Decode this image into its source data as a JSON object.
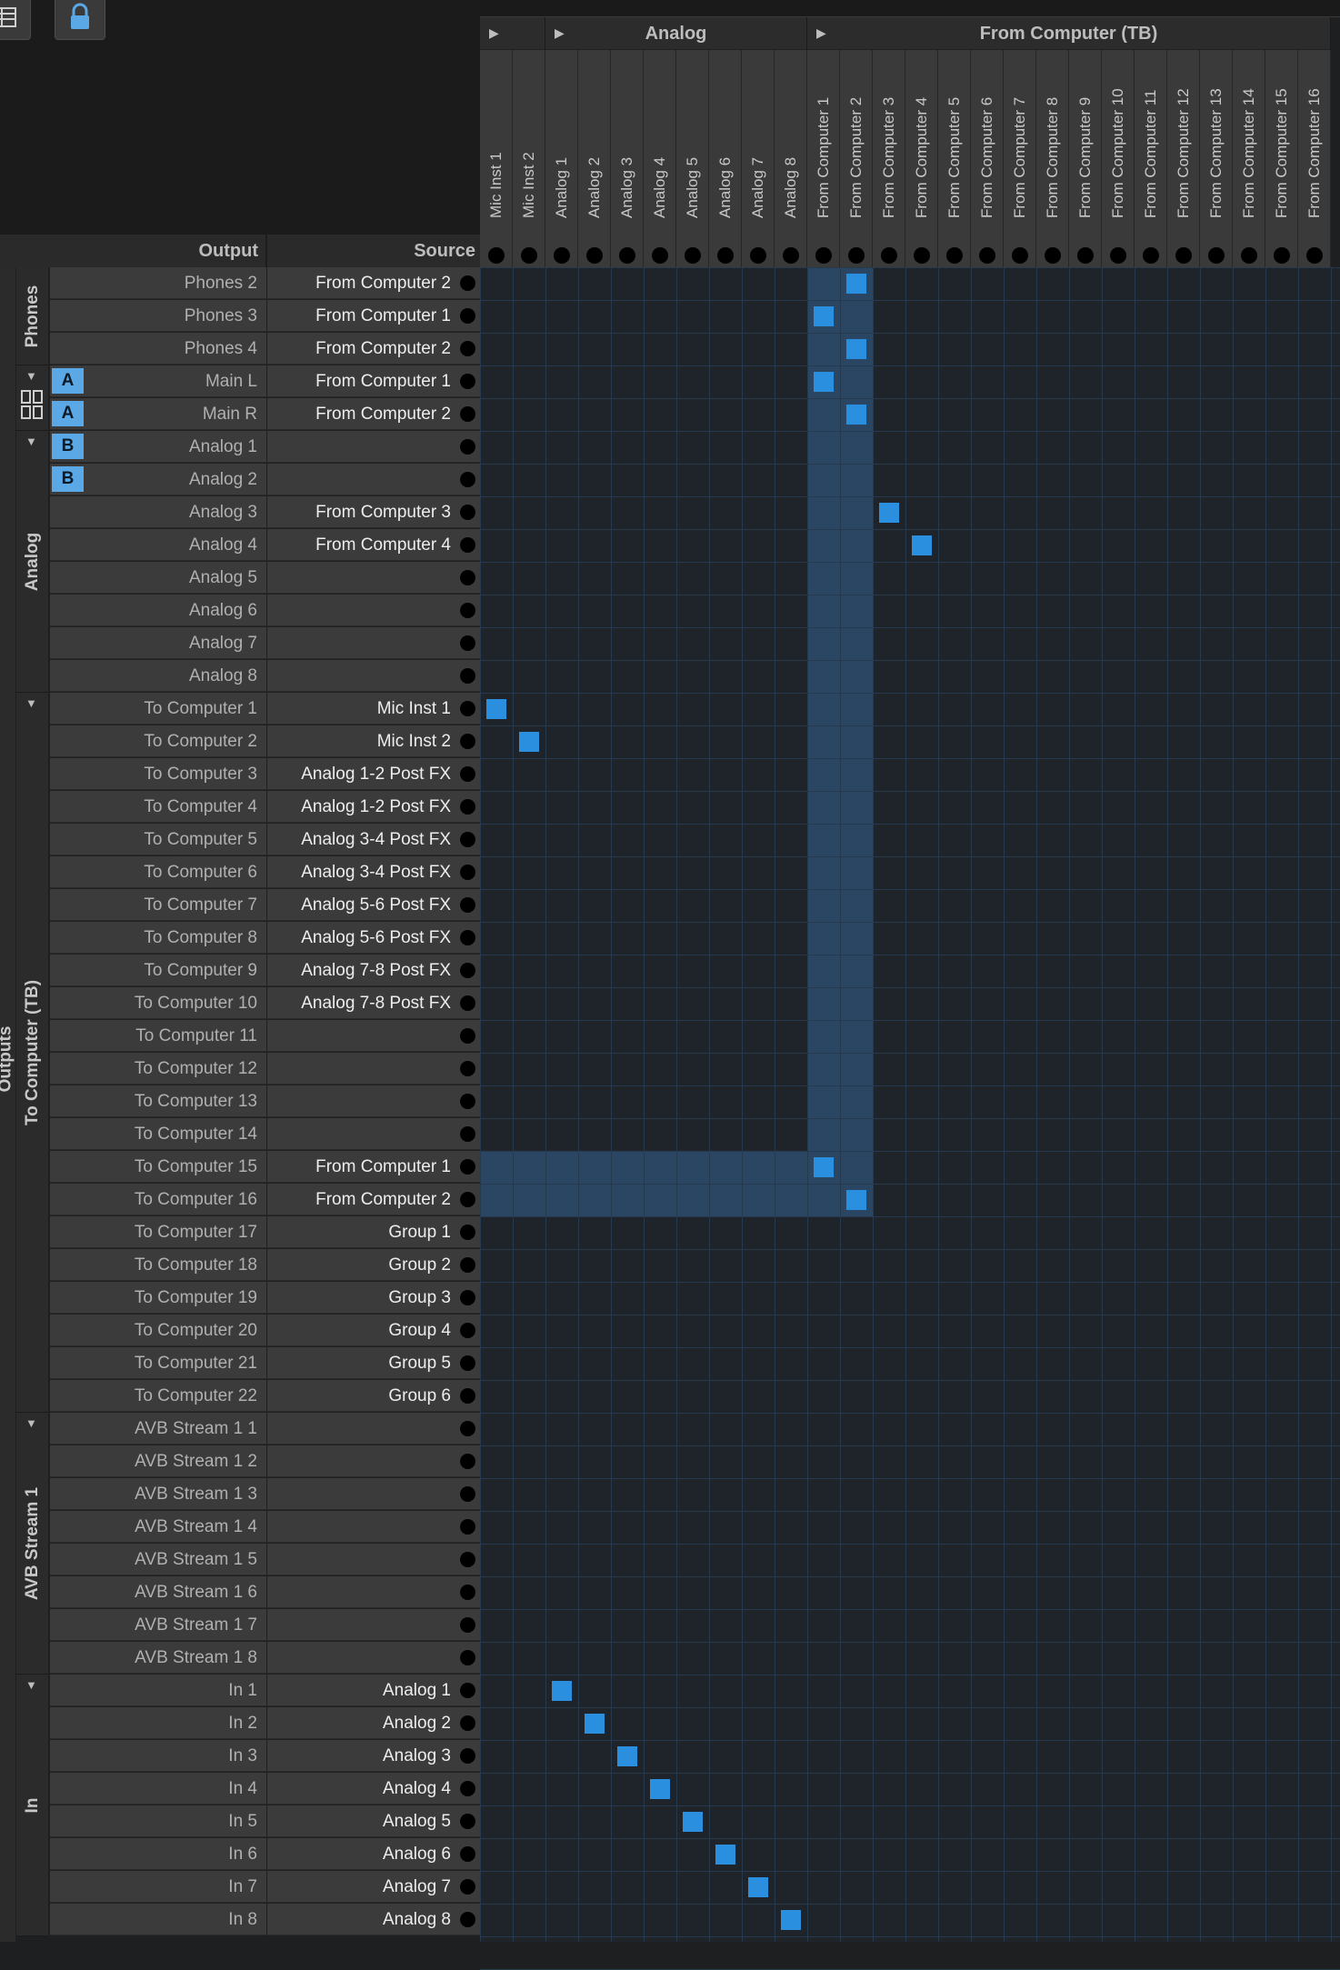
{
  "toolbar": {
    "grid_icon": "list-icon",
    "lock_icon": "lock-icon"
  },
  "headers": {
    "output": "Output",
    "source": "Source"
  },
  "column_groups": [
    {
      "label": "",
      "start": 0,
      "count": 2
    },
    {
      "label": "Analog",
      "start": 2,
      "count": 8
    },
    {
      "label": "From Computer (TB)",
      "start": 10,
      "count": 16
    }
  ],
  "columns": [
    "Mic Inst 1",
    "Mic Inst 2",
    "Analog 1",
    "Analog 2",
    "Analog 3",
    "Analog 4",
    "Analog 5",
    "Analog 6",
    "Analog 7",
    "Analog 8",
    "From Computer 1",
    "From Computer 2",
    "From Computer 3",
    "From Computer 4",
    "From Computer 5",
    "From Computer 6",
    "From Computer 7",
    "From Computer 8",
    "From Computer 9",
    "From Computer 10",
    "From Computer 11",
    "From Computer 12",
    "From Computer 13",
    "From Computer 14",
    "From Computer 15",
    "From Computer 16"
  ],
  "outer_label": "Outputs",
  "row_groups": [
    {
      "label": "Phones",
      "start": 0,
      "count": 3,
      "arrow": ""
    },
    {
      "label": "",
      "start": 3,
      "count": 2,
      "arrow": "▼",
      "icon": "speaker-pair-icon"
    },
    {
      "label": "Analog",
      "start": 5,
      "count": 8,
      "arrow": "▼"
    },
    {
      "label": "To Computer (TB)",
      "start": 13,
      "count": 22,
      "arrow": "▼"
    },
    {
      "label": "AVB Stream 1",
      "start": 35,
      "count": 8,
      "arrow": "▼"
    },
    {
      "label": "In",
      "start": 43,
      "count": 8,
      "arrow": "▼"
    }
  ],
  "rows": [
    {
      "output": "Phones 2",
      "source": "From Computer 2",
      "col": 11
    },
    {
      "output": "Phones 3",
      "source": "From Computer 1",
      "col": 10
    },
    {
      "output": "Phones 4",
      "source": "From Computer 2",
      "col": 11
    },
    {
      "output": "Main L",
      "source": "From Computer 1",
      "col": 10,
      "badge": "A"
    },
    {
      "output": "Main R",
      "source": "From Computer 2",
      "col": 11,
      "badge": "A"
    },
    {
      "output": "Analog 1",
      "source": "",
      "col": -1,
      "badge": "B"
    },
    {
      "output": "Analog 2",
      "source": "",
      "col": -1,
      "badge": "B"
    },
    {
      "output": "Analog 3",
      "source": "From Computer 3",
      "col": 12
    },
    {
      "output": "Analog 4",
      "source": "From Computer 4",
      "col": 13
    },
    {
      "output": "Analog 5",
      "source": "",
      "col": -1
    },
    {
      "output": "Analog 6",
      "source": "",
      "col": -1
    },
    {
      "output": "Analog 7",
      "source": "",
      "col": -1
    },
    {
      "output": "Analog 8",
      "source": "",
      "col": -1
    },
    {
      "output": "To Computer 1",
      "source": "Mic Inst 1",
      "col": 0
    },
    {
      "output": "To Computer 2",
      "source": "Mic Inst 2",
      "col": 1
    },
    {
      "output": "To Computer 3",
      "source": "Analog 1-2 Post FX",
      "col": -1
    },
    {
      "output": "To Computer 4",
      "source": "Analog 1-2 Post FX",
      "col": -1
    },
    {
      "output": "To Computer 5",
      "source": "Analog 3-4 Post FX",
      "col": -1
    },
    {
      "output": "To Computer 6",
      "source": "Analog 3-4 Post FX",
      "col": -1
    },
    {
      "output": "To Computer 7",
      "source": "Analog 5-6 Post FX",
      "col": -1
    },
    {
      "output": "To Computer 8",
      "source": "Analog 5-6 Post FX",
      "col": -1
    },
    {
      "output": "To Computer 9",
      "source": "Analog 7-8 Post FX",
      "col": -1
    },
    {
      "output": "To Computer 10",
      "source": "Analog 7-8 Post FX",
      "col": -1
    },
    {
      "output": "To Computer 11",
      "source": "",
      "col": -1
    },
    {
      "output": "To Computer 12",
      "source": "",
      "col": -1
    },
    {
      "output": "To Computer 13",
      "source": "",
      "col": -1
    },
    {
      "output": "To Computer 14",
      "source": "",
      "col": -1
    },
    {
      "output": "To Computer 15",
      "source": "From Computer 1",
      "col": 10
    },
    {
      "output": "To Computer 16",
      "source": "From Computer 2",
      "col": 11
    },
    {
      "output": "To Computer 17",
      "source": "Group 1",
      "col": -1
    },
    {
      "output": "To Computer 18",
      "source": "Group 2",
      "col": -1
    },
    {
      "output": "To Computer 19",
      "source": "Group 3",
      "col": -1
    },
    {
      "output": "To Computer 20",
      "source": "Group 4",
      "col": -1
    },
    {
      "output": "To Computer 21",
      "source": "Group 5",
      "col": -1
    },
    {
      "output": "To Computer 22",
      "source": "Group 6",
      "col": -1
    },
    {
      "output": "AVB Stream 1 1",
      "source": "",
      "col": -1
    },
    {
      "output": "AVB Stream 1 2",
      "source": "",
      "col": -1
    },
    {
      "output": "AVB Stream 1 3",
      "source": "",
      "col": -1
    },
    {
      "output": "AVB Stream 1 4",
      "source": "",
      "col": -1
    },
    {
      "output": "AVB Stream 1 5",
      "source": "",
      "col": -1
    },
    {
      "output": "AVB Stream 1 6",
      "source": "",
      "col": -1
    },
    {
      "output": "AVB Stream 1 7",
      "source": "",
      "col": -1
    },
    {
      "output": "AVB Stream 1 8",
      "source": "",
      "col": -1
    },
    {
      "output": "In 1",
      "source": "Analog 1",
      "col": 2
    },
    {
      "output": "In 2",
      "source": "Analog 2",
      "col": 3
    },
    {
      "output": "In 3",
      "source": "Analog 3",
      "col": 4
    },
    {
      "output": "In 4",
      "source": "Analog 4",
      "col": 5
    },
    {
      "output": "In 5",
      "source": "Analog 5",
      "col": 6
    },
    {
      "output": "In 6",
      "source": "Analog 6",
      "col": 7
    },
    {
      "output": "In 7",
      "source": "Analog 7",
      "col": 8
    },
    {
      "output": "In 8",
      "source": "Analog 8",
      "col": 9
    }
  ],
  "highlight": {
    "cols": [
      10,
      11
    ],
    "row_end": 28,
    "rows": [
      27,
      28
    ]
  },
  "colors": {
    "accent": "#2b8fe0",
    "badge": "#5aa8e6",
    "highlight": "#2b4663",
    "grid_line": "#253a4e"
  }
}
